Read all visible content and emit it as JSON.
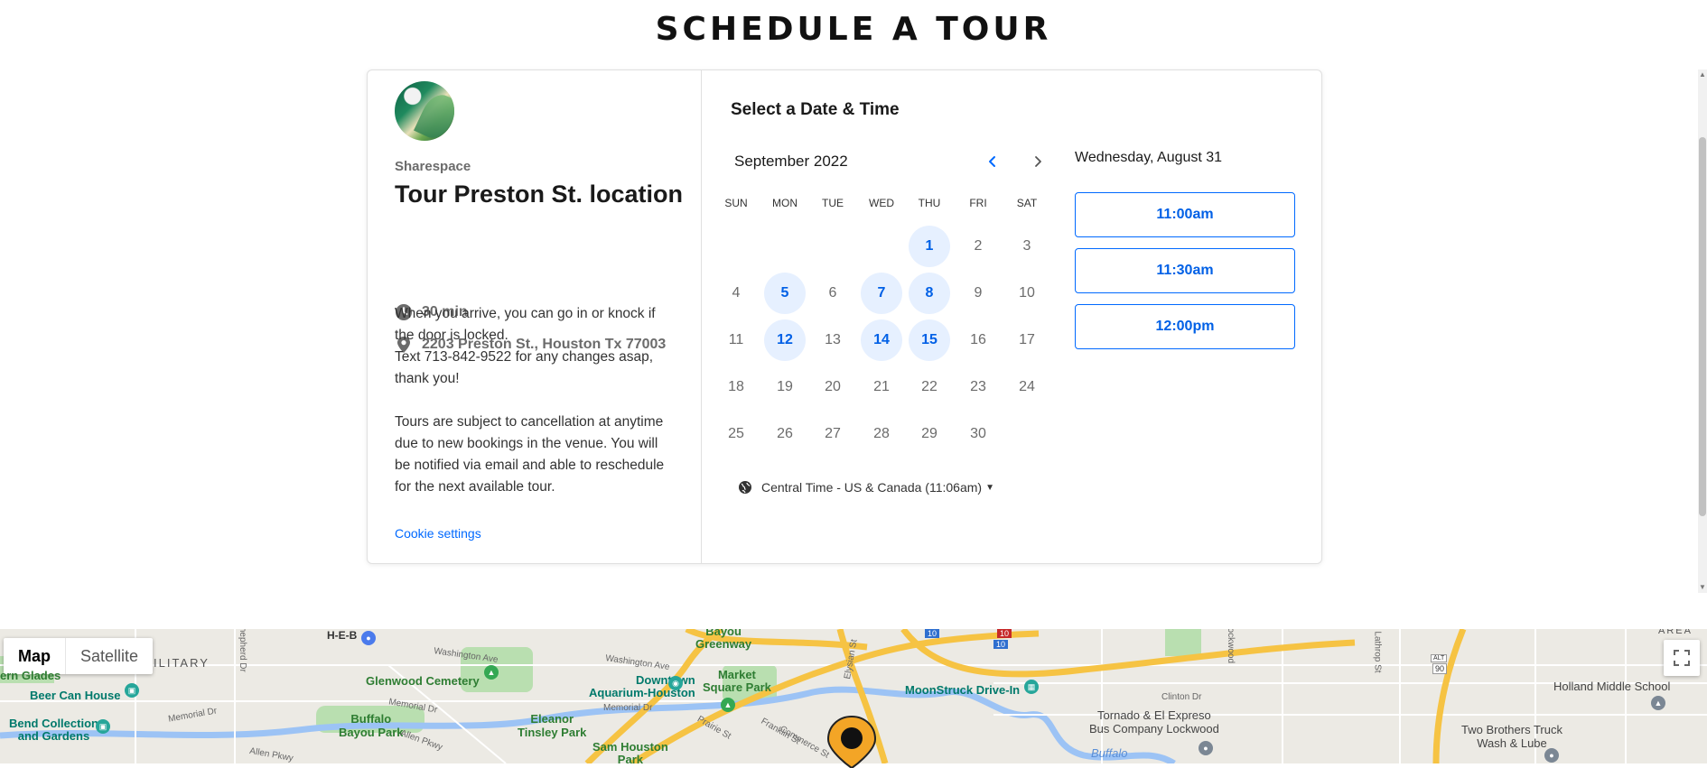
{
  "page": {
    "title": "SCHEDULE A TOUR"
  },
  "event": {
    "organizer": "Sharespace",
    "title": "Tour Preston St. location",
    "duration": "30 min",
    "address": "2203 Preston St., Houston Tx 77003",
    "description_lines": [
      "When you arrive, you can go in or knock if the door is locked.",
      "Text 713-842-9522 for any changes asap, thank you!",
      "Tours are subject to cancellation at anytime due to new bookings in the venue. You will be notified via email and able to reschedule for the next available tour."
    ],
    "cookie_settings": "Cookie settings"
  },
  "calendar": {
    "heading": "Select a Date & Time",
    "month": "September 2022",
    "weekdays": [
      "SUN",
      "MON",
      "TUE",
      "WED",
      "THU",
      "FRI",
      "SAT"
    ],
    "first_weekday_index": 4,
    "days_in_month": 30,
    "available_days": [
      1,
      5,
      7,
      8,
      12,
      14,
      15
    ],
    "timezone": "Central Time - US & Canada (11:06am)"
  },
  "time_slots": {
    "selected_date": "Wednesday, August 31",
    "slots": [
      "11:00am",
      "11:30am",
      "12:00pm"
    ]
  },
  "map": {
    "type_controls": {
      "map": "Map",
      "satellite": "Satellite"
    },
    "labels": {
      "heb": "H-E-B",
      "bayou_greenway": "Bayou\nGreenway",
      "military": "ILITARY",
      "washington_ave_1": "Washington Ave",
      "washington_ave_2": "Washington Ave",
      "glades": "ern Glades",
      "glenwood": "Glenwood Cemetery",
      "beer_can": "Beer Can House",
      "memorial_dr_1": "Memorial Dr",
      "memorial_dr_2": "Memorial Dr",
      "memorial_dr_3": "Memorial Dr",
      "buffalo_bayou_park": "Buffalo\nBayou Park",
      "bend_collection": "Bend Collection\nand Gardens",
      "allen_pkwy_1": "Allen Pkwy",
      "allen_pkwy_2": "Allen Pkwy",
      "eleanor": "Eleanor\nTinsley Park",
      "downtown": "Downtown\nAquarium-Houston",
      "market_square": "Market\nSquare Park",
      "sam_houston": "Sam Houston\nPark",
      "prairie_st": "Prairie St",
      "franklin_st": "Franklin St",
      "commerce_st": "Commerce St",
      "elysian_st": "Elysian St",
      "moonstruck": "MoonStruck Drive-In",
      "clinton_dr": "Clinton Dr",
      "tornado": "Tornado & El Expreso\nBus Company Lockwood",
      "holland": "Holland Middle School",
      "two_brothers": "Two Brothers Truck\nWash & Lube",
      "lathrop": "Lathrop St",
      "lockwood": "Lockwood",
      "buffalo": "Buffalo",
      "area": "AREA",
      "shepherd": "Shepherd Dr",
      "i10_a": "10",
      "i10_b": "10",
      "i10_c": "10",
      "alt90": "90",
      "alt90_top": "ALT"
    },
    "colors": {
      "highway": "#f6c343",
      "water": "#9cc3f5",
      "park": "#b9dfb0",
      "marker": "#f3a526"
    }
  },
  "colors": {
    "accent": "#0069ff",
    "available_bg": "#e6f0ff"
  }
}
